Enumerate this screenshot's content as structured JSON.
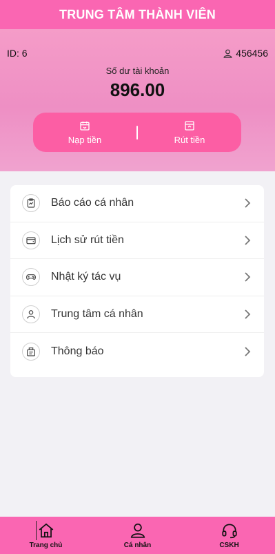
{
  "header": {
    "title": "TRUNG TÂM THÀNH VIÊN"
  },
  "account": {
    "id_text": "ID: 6",
    "username": "456456",
    "balance_label": "Số dư tài khoản",
    "balance": "896.00"
  },
  "actions": {
    "deposit_label": "Nạp tiền",
    "withdraw_label": "Rút tiền"
  },
  "menu": {
    "items": [
      {
        "label": "Báo cáo cá nhân",
        "icon": "report-chart-icon"
      },
      {
        "label": "Lịch sử rút tiền",
        "icon": "wallet-icon"
      },
      {
        "label": "Nhật ký tác vụ",
        "icon": "gamepad-icon"
      },
      {
        "label": "Trung tâm cá nhân",
        "icon": "user-icon"
      },
      {
        "label": "Thông báo",
        "icon": "notification-icon"
      }
    ]
  },
  "tabbar": {
    "items": [
      {
        "label": "Trang chủ",
        "icon": "home-icon"
      },
      {
        "label": "Cá nhân",
        "icon": "user-icon"
      },
      {
        "label": "CSKH",
        "icon": "headset-icon"
      }
    ]
  },
  "colors": {
    "primary": "#fa66b2",
    "action_box": "#fc5ea4",
    "banner": "#ee8fc4",
    "background": "#f2f1f5"
  }
}
